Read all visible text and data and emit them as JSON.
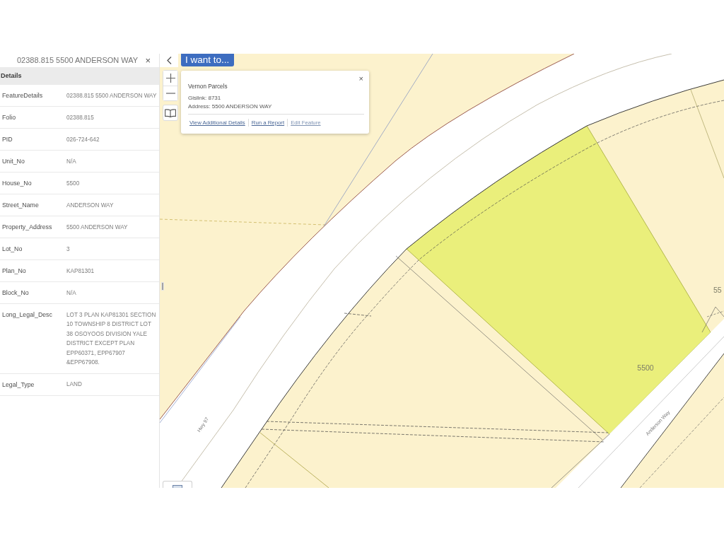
{
  "side_panel": {
    "title": "02388.815 5500 ANDERSON WAY",
    "close": "×",
    "section": "Details",
    "fields": [
      {
        "label": "FeatureDetails",
        "value": "02388.815 5500 ANDERSON WAY"
      },
      {
        "label": "Folio",
        "value": "02388.815"
      },
      {
        "label": "PID",
        "value": "026-724-642"
      },
      {
        "label": "Unit_No",
        "value": "N/A"
      },
      {
        "label": "House_No",
        "value": "5500"
      },
      {
        "label": "Street_Name",
        "value": "ANDERSON WAY"
      },
      {
        "label": "Property_Address",
        "value": "5500 ANDERSON WAY"
      },
      {
        "label": "Lot_No",
        "value": "3"
      },
      {
        "label": "Plan_No",
        "value": "KAP81301"
      },
      {
        "label": "Block_No",
        "value": "N/A"
      },
      {
        "label": "Long_Legal_Desc",
        "value": "LOT 3 PLAN KAP81301 SECTION 10 TOWNSHIP 8 DISTRICT LOT 38 OSOYOOS DIVISION YALE DISTRICT EXCEPT PLAN EPP60371, EPP67907 &EPP67908."
      },
      {
        "label": "Legal_Type",
        "value": "LAND"
      }
    ]
  },
  "map": {
    "menu_button": "I want to...",
    "popup": {
      "title": "Vernon Parcels",
      "close": "×",
      "lines": [
        "Gislink: 8731",
        "Address: 5500 ANDERSON WAY"
      ],
      "links": [
        {
          "label": "View Additional Details",
          "disabled": false
        },
        {
          "label": "Run a Report",
          "disabled": false
        },
        {
          "label": "Edit Feature",
          "disabled": true
        }
      ]
    },
    "labels": [
      {
        "text": "Hwy 97",
        "kind": "road"
      },
      {
        "text": "5500",
        "kind": "parcel"
      },
      {
        "text": "Anderson Way",
        "kind": "road"
      },
      {
        "text": "55",
        "kind": "parcel"
      }
    ]
  }
}
